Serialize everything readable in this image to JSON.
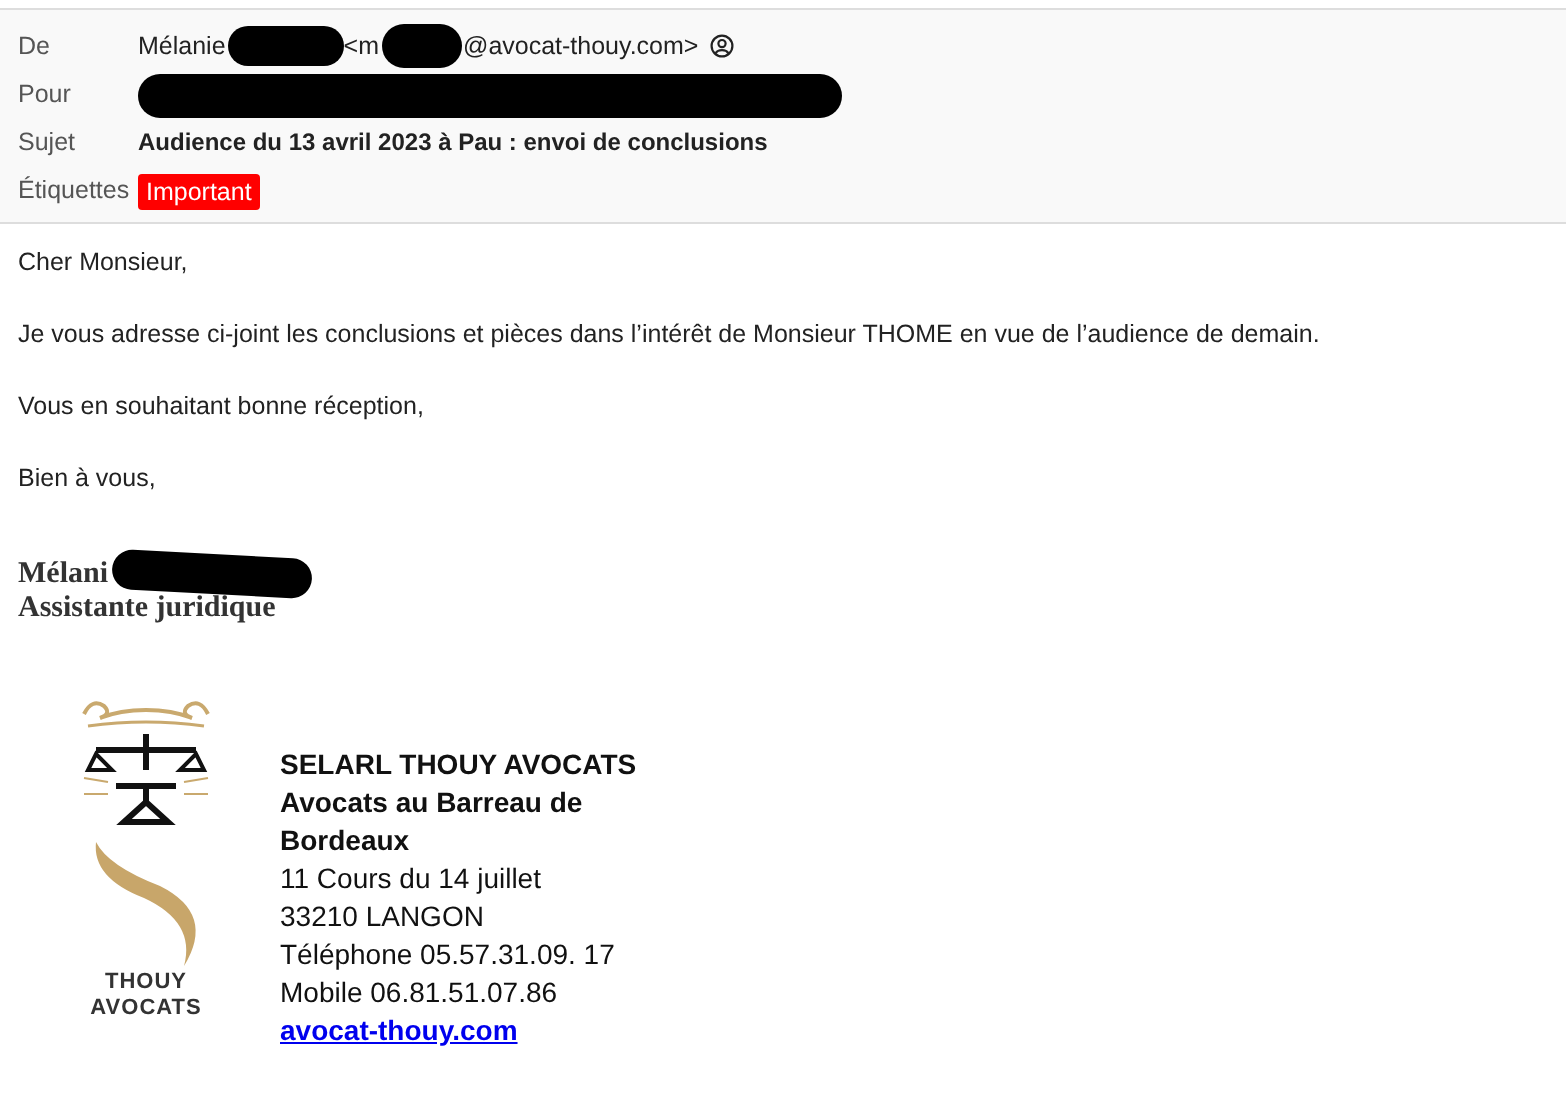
{
  "header": {
    "fields": [
      {
        "kind": "from",
        "label": "De",
        "name": "Mélanie",
        "address_start": "<m",
        "address_end": "@avocat-thouy.com>"
      },
      {
        "kind": "to",
        "label": "Pour"
      },
      {
        "kind": "subject",
        "label": "Sujet",
        "value": "Audience du 13 avril 2023 à Pau : envoi de conclusions"
      },
      {
        "kind": "tags",
        "label": "Étiquettes",
        "tags": [
          {
            "text": "Important",
            "color": "#ff0000"
          }
        ]
      }
    ]
  },
  "body": {
    "paragraphs": [
      "Cher Monsieur,",
      "Je vous adresse ci-joint les conclusions et pièces dans l’intérêt de Monsieur THOME en vue de l’audience de demain.",
      "Vous en souhaitant bonne réception,",
      "Bien à vous,"
    ],
    "signature": {
      "name": "Mélani",
      "role": "Assistante juridique"
    }
  },
  "footer": {
    "logo_lines": [
      "THOUY",
      "AVOCATS"
    ],
    "lines": [
      {
        "kind": "bold",
        "text": "SELARL THOUY AVOCATS"
      },
      {
        "kind": "bold",
        "text": "Avocats au Barreau de"
      },
      {
        "kind": "bold",
        "text": "Bordeaux"
      },
      {
        "kind": "plain",
        "text": "11 Cours du 14 juillet"
      },
      {
        "kind": "plain",
        "text": "33210 LANGON"
      },
      {
        "kind": "plain",
        "text": "Téléphone 05.57.31.09. 17"
      },
      {
        "kind": "plain",
        "text": "Mobile 06.81.51.07.86"
      },
      {
        "kind": "link",
        "text": "avocat-thouy.com"
      }
    ]
  }
}
